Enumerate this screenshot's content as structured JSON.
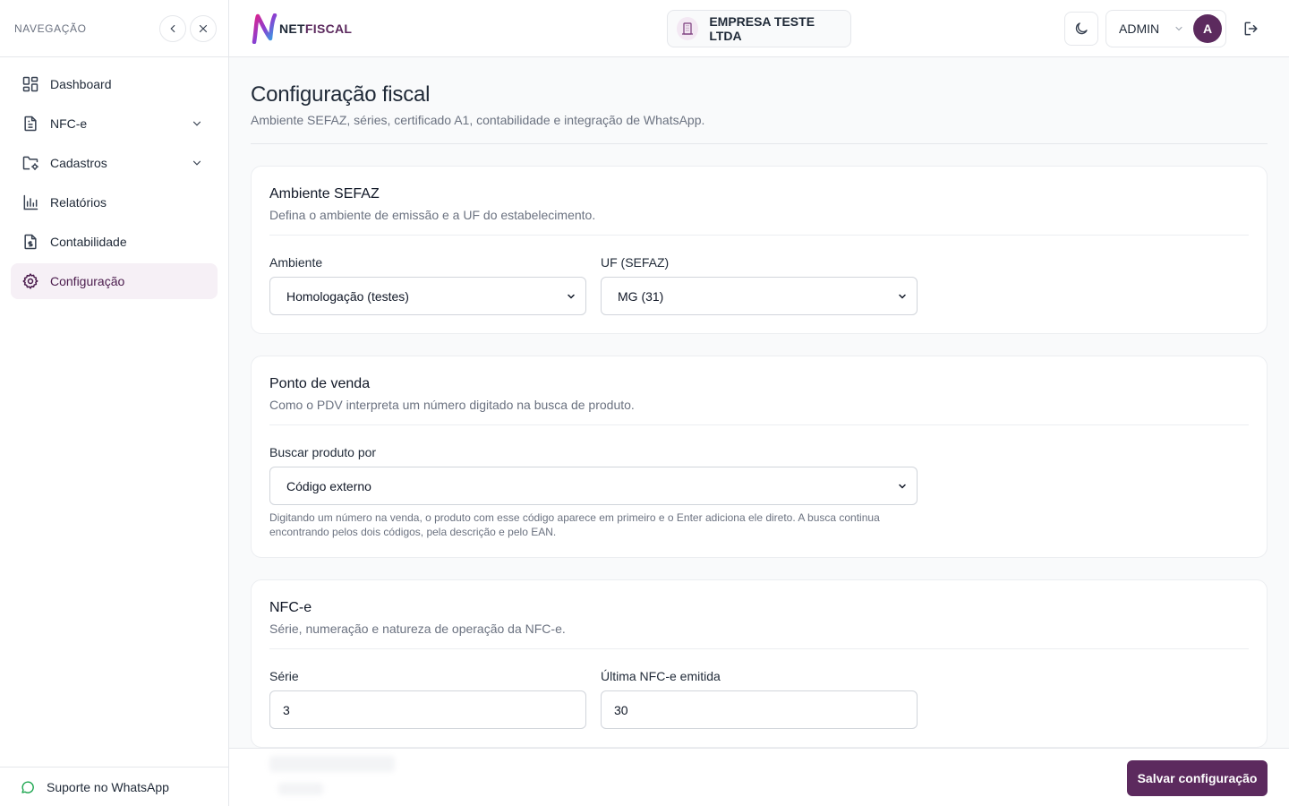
{
  "sidebar": {
    "title": "NAVEGAÇÃO",
    "items": [
      {
        "label": "Dashboard",
        "icon": "dashboard-icon"
      },
      {
        "label": "NFC-e",
        "icon": "document-icon",
        "expandable": true
      },
      {
        "label": "Cadastros",
        "icon": "folder-gear-icon",
        "expandable": true
      },
      {
        "label": "Relatórios",
        "icon": "bar-chart-icon"
      },
      {
        "label": "Contabilidade",
        "icon": "file-dollar-icon"
      },
      {
        "label": "Configuração",
        "icon": "gear-icon",
        "active": true
      }
    ],
    "support_label": "Suporte no WhatsApp"
  },
  "header": {
    "logo_part1": "NET",
    "logo_part2": "FISCAL",
    "company": "EMPRESA TESTE LTDA",
    "user": "ADMIN",
    "avatar_initial": "A"
  },
  "page": {
    "title": "Configuração fiscal",
    "subtitle": "Ambiente SEFAZ, séries, certificado A1, contabilidade e integração de WhatsApp."
  },
  "cards": {
    "sefaz": {
      "title": "Ambiente SEFAZ",
      "description": "Defina o ambiente de emissão e a UF do estabelecimento.",
      "ambiente_label": "Ambiente",
      "ambiente_value": "Homologação (testes)",
      "uf_label": "UF (SEFAZ)",
      "uf_value": "MG (31)"
    },
    "pdv": {
      "title": "Ponto de venda",
      "description": "Como o PDV interpreta um número digitado na busca de produto.",
      "buscar_label": "Buscar produto por",
      "buscar_value": "Código externo",
      "help": "Digitando um número na venda, o produto com esse código aparece em primeiro e o Enter adiciona ele direto. A busca continua encontrando pelos dois códigos, pela descrição e pelo EAN."
    },
    "nfce": {
      "title": "NFC-e",
      "description": "Série, numeração e natureza de operação da NFC-e.",
      "serie_label": "Série",
      "serie_value": "3",
      "ultima_label": "Última NFC-e emitida",
      "ultima_value": "30"
    }
  },
  "footer": {
    "save_label": "Salvar configuração"
  },
  "colors": {
    "primary": "#5c2a5e",
    "active_bg": "#f6f0f6"
  }
}
